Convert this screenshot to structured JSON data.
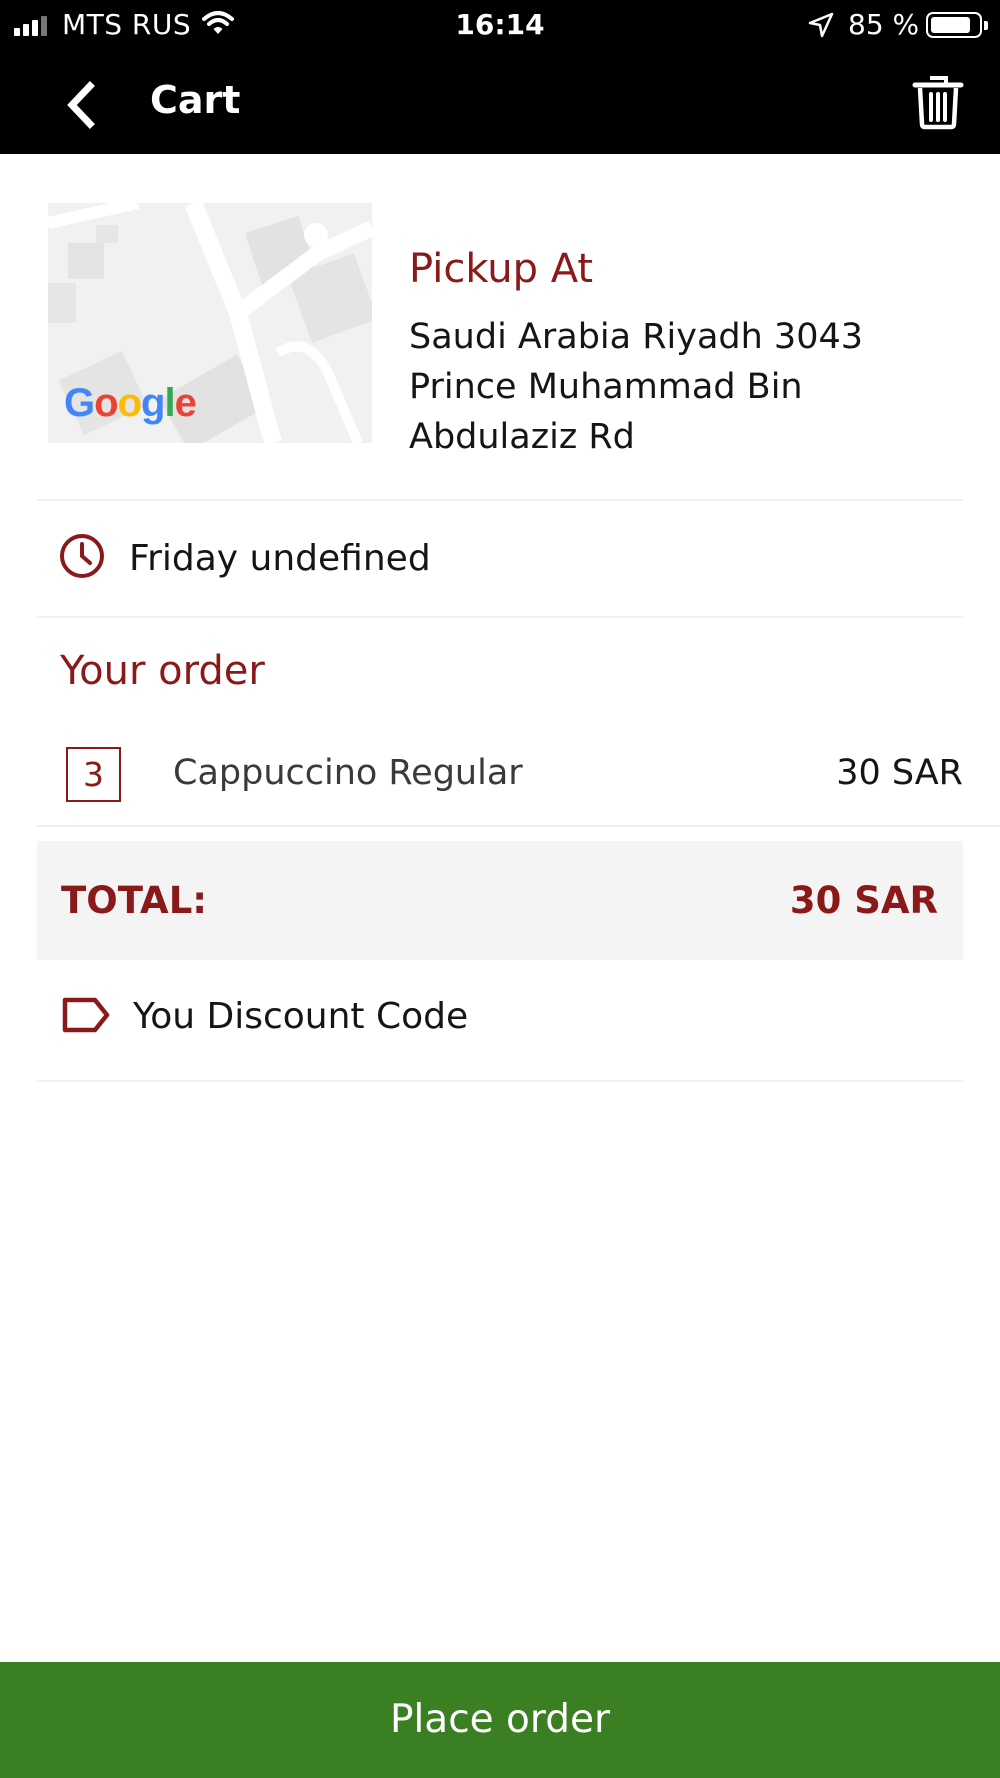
{
  "status_bar": {
    "carrier": "MTS RUS",
    "time": "16:14",
    "battery_percent": "85 %",
    "battery_level": 0.85
  },
  "nav": {
    "title": "Cart",
    "back_icon": "chevron-left-icon",
    "trash_icon": "trash-icon"
  },
  "pickup": {
    "map_logo": "Google",
    "title": "Pickup At",
    "address": "Saudi Arabia Riyadh 3043 Prince Muhammad Bin Abdulaziz Rd"
  },
  "schedule": {
    "icon": "clock-icon",
    "label": "Friday undefined"
  },
  "order": {
    "heading": "Your order",
    "items": [
      {
        "qty": "3",
        "name": "Cappuccino Regular",
        "price": "30 SAR"
      }
    ]
  },
  "total": {
    "label": "TOTAL:",
    "value": "30 SAR"
  },
  "discount": {
    "icon": "tag-icon",
    "label": "You Discount Code"
  },
  "actions": {
    "place_order": "Place order"
  },
  "colors": {
    "accent": "#8a1a1a",
    "primary_button": "#3a7f22",
    "header": "#000000"
  }
}
